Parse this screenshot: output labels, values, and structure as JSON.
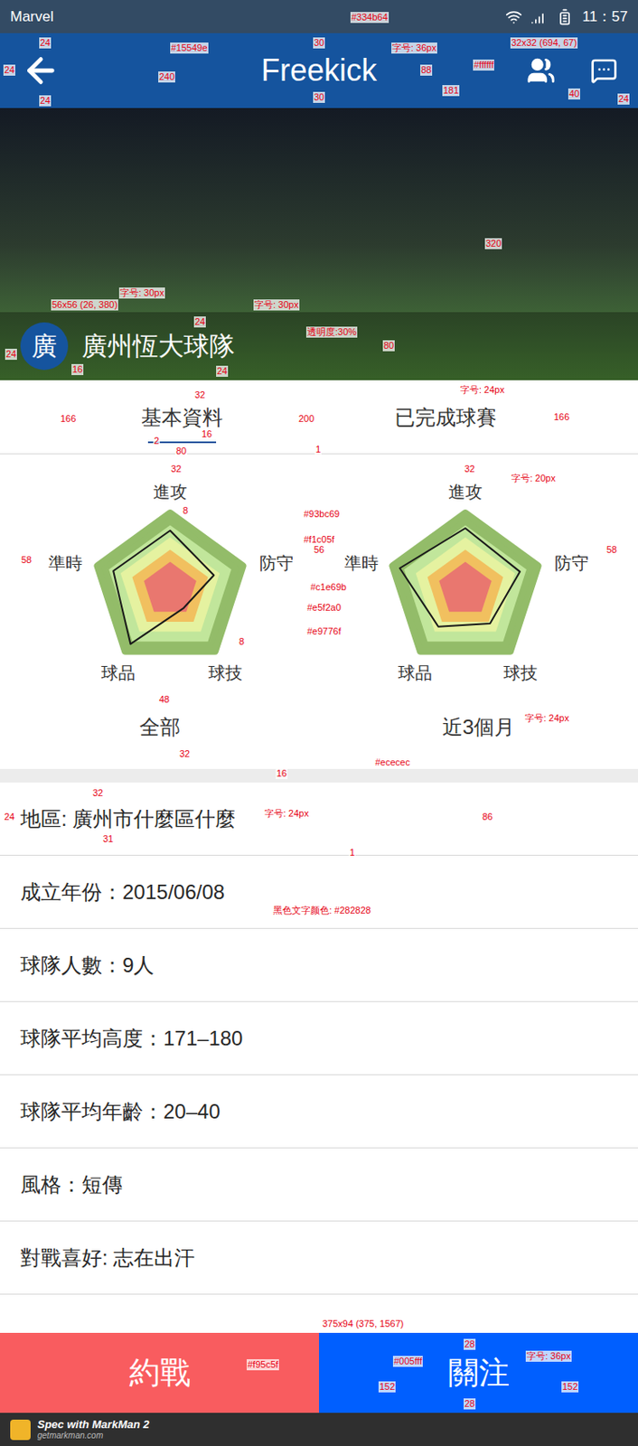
{
  "status_bar": {
    "carrier": "Marvel",
    "time": "11：57"
  },
  "header": {
    "title": "Freekick"
  },
  "team": {
    "avatar": "廣",
    "name": "廣州恆大球隊"
  },
  "tabs": [
    {
      "label": "基本資料",
      "selected": true
    },
    {
      "label": "已完成球賽",
      "selected": false
    }
  ],
  "radar": {
    "axes": [
      "進攻",
      "防守",
      "球技",
      "球品",
      "準時"
    ],
    "max": 100,
    "layers": [
      {
        "share": 1.0,
        "color": "#93bc69"
      },
      {
        "share": 0.84,
        "color": "#c1e69b"
      },
      {
        "share": 0.68,
        "color": "#e5f2a0"
      },
      {
        "share": 0.52,
        "color": "#f1c05f"
      },
      {
        "share": 0.36,
        "color": "#e9776f"
      }
    ],
    "charts": [
      {
        "caption": "全部",
        "values": [
          77,
          60,
          30,
          88,
          78
        ]
      },
      {
        "caption": "近3個月",
        "values": [
          80,
          75,
          55,
          60,
          90
        ]
      }
    ]
  },
  "info_rows": [
    "地區: 廣州市什麼區什麼",
    "成立年份：2015/06/08",
    "球隊人數：9人",
    "球隊平均高度：171–180",
    "球隊平均年齡：20–40",
    "風格：短傳",
    "對戰喜好: 志在出汗"
  ],
  "buttons": [
    {
      "label": "約戰",
      "color": "#f95c5f"
    },
    {
      "label": "關注",
      "color": "#005fff"
    }
  ],
  "footer": {
    "brand": "Spec with MarkMan 2",
    "url": "getmarkman.com"
  },
  "annotations": [
    "#334b64",
    "#15549e",
    "24",
    "24",
    "24",
    "240",
    "30",
    "30",
    "字号: 36px",
    "88",
    "#ffffff",
    "32x32 (694, 67)",
    "181",
    "40",
    "24",
    "320",
    "56x56 (26, 380)",
    "字号: 30px",
    "字号: 30px",
    "24",
    "透明度:30%",
    "80",
    "24",
    "16",
    "24",
    "32",
    "166",
    "16",
    "200",
    "166",
    "字号: 24px",
    "2",
    "80",
    "1",
    "32",
    "32",
    "字号: 20px",
    "8",
    "#93bc69",
    "#f1c05f",
    "#c1e69b",
    "#e5f2a0",
    "#e9776f",
    "58",
    "56",
    "58",
    "8",
    "48",
    "32",
    "字号: 24px",
    "16",
    "#ececec",
    "32",
    "24",
    "字号: 24px",
    "31",
    "86",
    "1",
    "黑色文字颜色: #282828",
    "375x94 (375, 1567)",
    "28",
    "#005fff",
    "字号: 36px",
    "#f95c5f",
    "152",
    "152",
    "28"
  ]
}
